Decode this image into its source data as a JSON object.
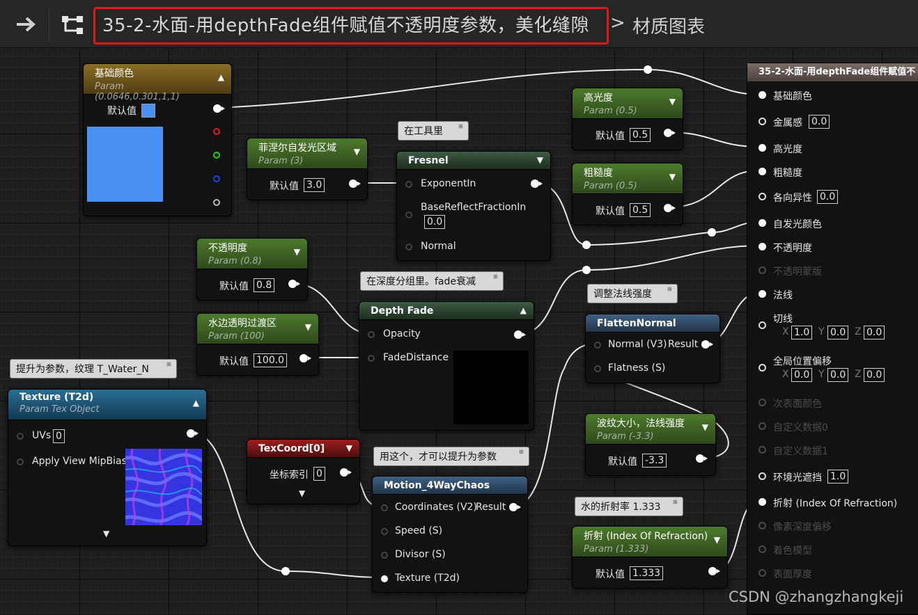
{
  "window": {
    "title": "35-2-水面-用depthFade组件赋值不透明度参数，美化缝隙",
    "breadcrumb_sep": ">",
    "breadcrumb": "材质图表"
  },
  "nodes": {
    "base_color": {
      "title": "基础颜色",
      "subtitle": "Param (0.0646,0.301,1,1)",
      "default_label": "默认值",
      "swatch": "#4A90F0"
    },
    "fresnel_param": {
      "title": "菲涅尔自发光区域",
      "subtitle": "Param (3)",
      "default_label": "默认值",
      "value": "3.0"
    },
    "opacity_param": {
      "title": "不透明度",
      "subtitle": "Param (0.8)",
      "default_label": "默认值",
      "value": "0.8"
    },
    "shore_param": {
      "title": "水边透明过渡区",
      "subtitle": "Param (100)",
      "default_label": "默认值",
      "value": "100.0"
    },
    "texture": {
      "title": "Texture (T2d)",
      "subtitle": "Param Tex Object",
      "pin_uvs": "UVs",
      "uvs_value": "0",
      "pin_mip": "Apply View MipBias"
    },
    "fresnel": {
      "title": "Fresnel",
      "pin_exp": "ExponentIn",
      "pin_base": "BaseReflectFractionIn",
      "base_value": "0.0",
      "pin_normal": "Normal"
    },
    "depth_fade": {
      "title": "Depth Fade",
      "pin_opacity": "Opacity",
      "pin_fade": "FadeDistance"
    },
    "specular_param": {
      "title": "高光度",
      "subtitle": "Param (0.5)",
      "default_label": "默认值",
      "value": "0.5"
    },
    "roughness_param": {
      "title": "粗糙度",
      "subtitle": "Param (0.5)",
      "default_label": "默认值",
      "value": "0.5"
    },
    "flatten_normal": {
      "title": "FlattenNormal",
      "pin_normal": "Normal (V3)",
      "pin_result": "Result",
      "pin_flat": "Flatness (S)"
    },
    "wave_param": {
      "title": "波纹大小，法线强度",
      "subtitle": "Param (-3.3)",
      "default_label": "默认值",
      "value": "-3.3"
    },
    "texcoord": {
      "title": "TexCoord[0]",
      "index_label": "坐标索引",
      "index_value": "0"
    },
    "motion": {
      "title": "Motion_4WayChaos",
      "pin_coords": "Coordinates (V2)",
      "pin_result": "Result",
      "pin_speed": "Speed (S)",
      "pin_divisor": "Divisor (S)",
      "pin_tex": "Texture (T2d)"
    },
    "refraction_param": {
      "title": "折射 (Index Of Refraction)",
      "subtitle": "Param (1.333)",
      "default_label": "默认值",
      "value": "1.333"
    }
  },
  "comments": {
    "fresnel": "在工具里",
    "depth": "在深度分组里。fade衰减",
    "texture": "提升为参数，纹理 T_Water_N",
    "motion": "用这个，才可以提升为参数",
    "flatten": "调整法线强度",
    "refraction": "水的折射率 1.333"
  },
  "result_node": {
    "title": "35-2-水面-用depthFade组件赋值不",
    "pins": [
      {
        "label": "基础颜色",
        "state": "connected"
      },
      {
        "label": "金属感",
        "state": "open",
        "value": "0.0"
      },
      {
        "label": "高光度",
        "state": "connected"
      },
      {
        "label": "粗糙度",
        "state": "connected"
      },
      {
        "label": "各向异性",
        "state": "open",
        "value": "0.0"
      },
      {
        "label": "自发光颜色",
        "state": "connected"
      },
      {
        "label": "不透明度",
        "state": "connected"
      },
      {
        "label": "不透明蒙版",
        "state": "disabled"
      },
      {
        "label": "法线",
        "state": "connected"
      },
      {
        "label": "切线",
        "state": "open",
        "x": "1.0",
        "y": "0.0",
        "z": "0.0"
      },
      {
        "label": "全局位置偏移",
        "state": "open",
        "x": "0.0",
        "y": "0.0",
        "z": "0.0"
      },
      {
        "label": "次表面颜色",
        "state": "disabled"
      },
      {
        "label": "自定义数据0",
        "state": "disabled"
      },
      {
        "label": "自定义数据1",
        "state": "disabled"
      },
      {
        "label": "环境光遮挡",
        "state": "open",
        "value": "1.0"
      },
      {
        "label": "折射 (Index Of Refraction)",
        "state": "connected"
      },
      {
        "label": "像素深度偏移",
        "state": "disabled"
      },
      {
        "label": "着色模型",
        "state": "disabled"
      },
      {
        "label": "表面厚度",
        "state": "disabled"
      }
    ],
    "axis_x": "X",
    "axis_y": "Y",
    "axis_z": "Z"
  },
  "watermark": "CSDN @zhangzhangkeji",
  "colors": {
    "accent_red": "#E01818",
    "param_green": "#4D7A2C",
    "func_blue": "#2A6E94"
  }
}
